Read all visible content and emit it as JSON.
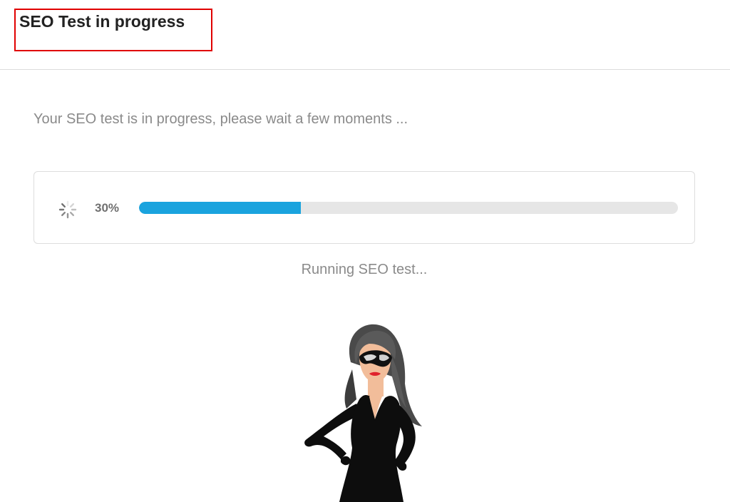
{
  "header": {
    "title": "SEO Test in progress"
  },
  "main": {
    "intro": "Your SEO test is in progress, please wait a few moments ...",
    "progress": {
      "percent_label": "30%",
      "fraction": 0.3,
      "bar_color": "#1aa3de",
      "track_color": "#e6e6e6"
    },
    "status": "Running SEO test...",
    "mascot": {
      "icon": "woman-in-black-dress-with-sunglasses"
    }
  },
  "colors": {
    "highlight_border": "#e00000"
  }
}
